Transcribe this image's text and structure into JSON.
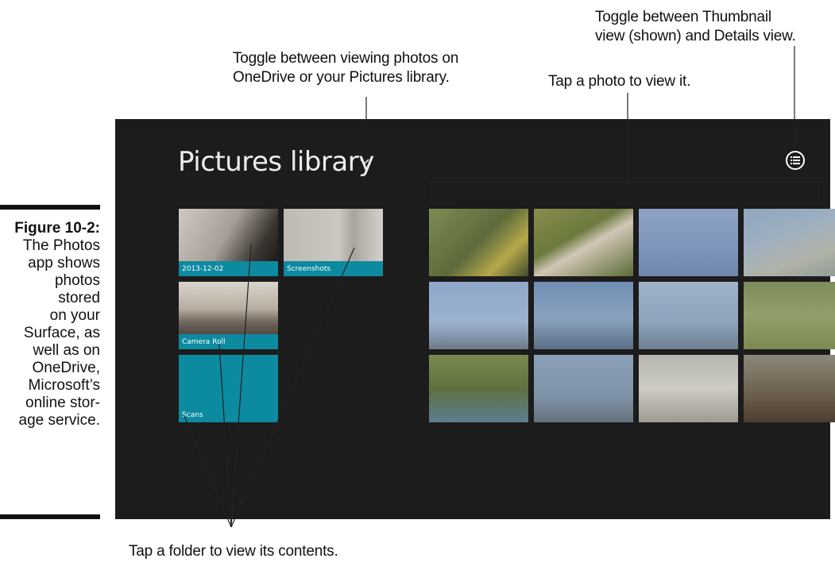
{
  "callouts": {
    "toggle_source": [
      "Toggle between viewing photos on",
      "OneDrive or your Pictures library."
    ],
    "tap_photo": "Tap a photo to view it.",
    "toggle_view": [
      "Toggle between Thumbnail",
      "view (shown) and Details view."
    ],
    "tap_folder": "Tap a folder to view its contents."
  },
  "figure": {
    "number": "Figure 10-2:",
    "caption": "The Photos app shows photos stored on your Surface, as well as on OneDrive, Microsoft’s online storage service.",
    "caption_lines": [
      "The Photos",
      "app shows",
      "photos",
      "stored",
      "on your",
      "Surface, as",
      "well as on",
      "OneDrive,",
      "Microsoft’s",
      "online stor-",
      "age service."
    ]
  },
  "app": {
    "title": "Pictures library",
    "title_chevron_icon": "chevron-down-icon",
    "view_toggle_icon": "list-view-icon",
    "accent_color": "#0c8aa0",
    "background_color": "#1c1c1c",
    "folders": [
      {
        "label": "2013-12-02"
      },
      {
        "label": "Screenshots"
      },
      {
        "label": "Camera Roll"
      },
      {
        "label": "Scans"
      }
    ],
    "photos": [
      {
        "subject": "warbler on branch"
      },
      {
        "subject": "egrets in flight"
      },
      {
        "subject": "sandpiper in water"
      },
      {
        "subject": "shorebird flock"
      },
      {
        "subject": "birds on bare branches"
      },
      {
        "subject": "dowitcher in water"
      },
      {
        "subject": "heron wading"
      },
      {
        "subject": "plover on grass"
      },
      {
        "subject": "curlew in marsh"
      },
      {
        "subject": "dowitcher flock"
      },
      {
        "subject": "horned lark"
      },
      {
        "subject": "sandpipers on debris"
      }
    ]
  }
}
